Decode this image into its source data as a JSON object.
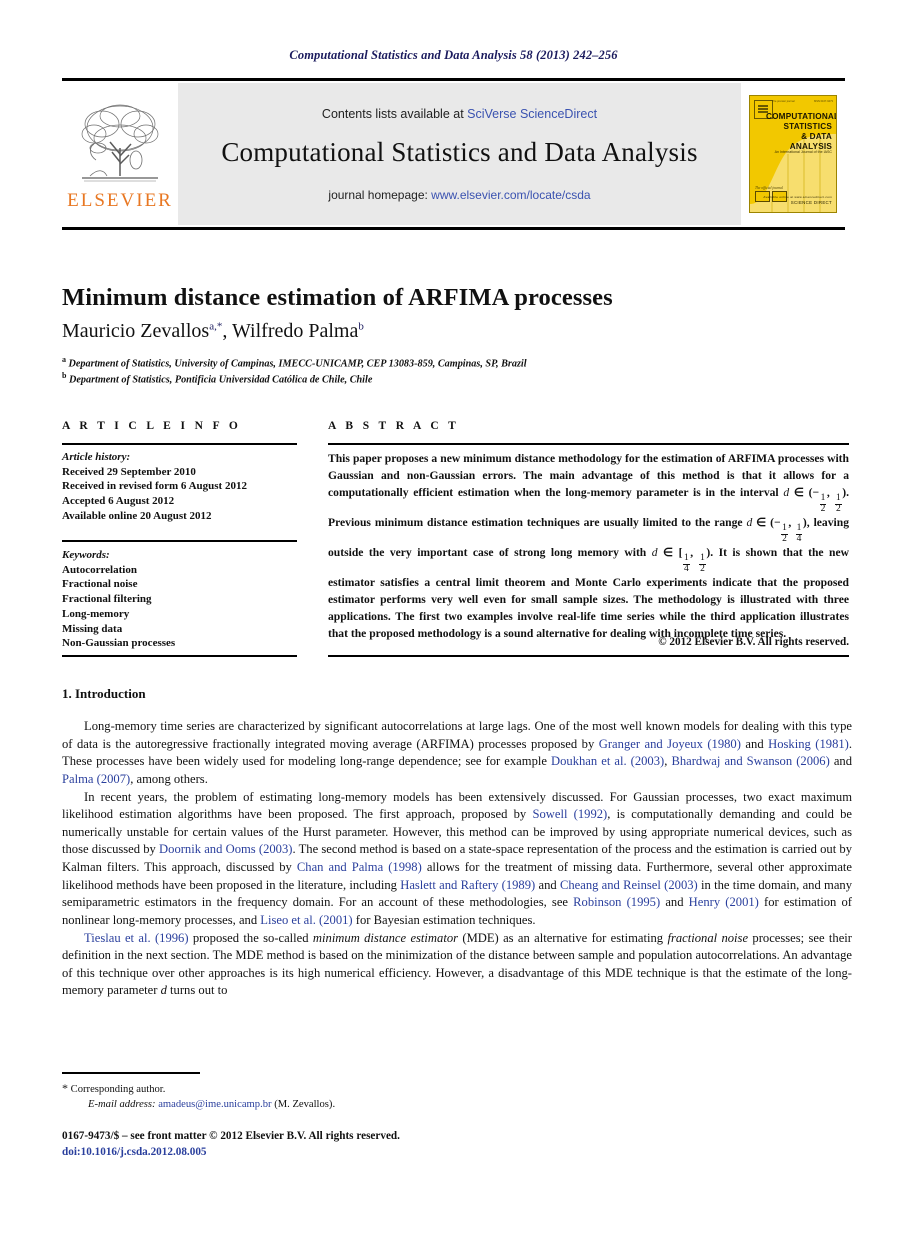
{
  "running_head": "Computational Statistics and Data Analysis 58 (2013) 242–256",
  "masthead": {
    "contents_prefix": "Contents lists available at ",
    "contents_link": "SciVerse ScienceDirect",
    "journal_title": "Computational Statistics and Data Analysis",
    "homepage_prefix": "journal homepage: ",
    "homepage_link": "www.elsevier.com/locate/csda",
    "publisher_wordmark": "ELSEVIER",
    "band_bg": "#e9e9e9",
    "link_color": "#3a52b0",
    "elsevier_orange": "#E87722",
    "cover": {
      "top_left_label": "The premier journal",
      "top_right_label": "ISSN 0167-9473",
      "title_lines": [
        "COMPUTATIONAL",
        "STATISTICS",
        "& DATA ANALYSIS"
      ],
      "subtitle": "An International Journal of the IASC",
      "quote": "The official journal",
      "bottom_small": "Available online at www.sciencedirect.com",
      "bottom_big": "SCIENCE DIRECT",
      "bg": "#F2C800"
    }
  },
  "article": {
    "title": "Minimum distance estimation of ARFIMA processes",
    "authors": [
      {
        "name": "Mauricio Zevallos",
        "marks": "a,*"
      },
      {
        "name": "Wilfredo Palma",
        "marks": "b"
      }
    ],
    "affiliations": [
      {
        "mark": "a",
        "text": "Department of Statistics, University of Campinas, IMECC-UNICAMP, CEP 13083-859, Campinas, SP, Brazil"
      },
      {
        "mark": "b",
        "text": "Department of Statistics, Pontificia Universidad Católica de Chile, Chile"
      }
    ]
  },
  "article_info": {
    "heading": "A R T I C L E   I N F O",
    "history_label": "Article history:",
    "history": [
      "Received 29 September 2010",
      "Received in revised form 6 August 2012",
      "Accepted 6 August 2012",
      "Available online 20 August 2012"
    ],
    "keywords_label": "Keywords:",
    "keywords": [
      "Autocorrelation",
      "Fractional noise",
      "Fractional filtering",
      "Long-memory",
      "Missing data",
      "Non-Gaussian processes"
    ]
  },
  "abstract": {
    "heading": "A B S T R A C T",
    "part1": "This paper proposes a new minimum distance methodology for the estimation of ARFIMA processes with Gaussian and non-Gaussian errors. The main advantage of this method is that it allows for a computationally efficient estimation when the long-memory parameter is in the interval ",
    "interval1_var": "d",
    "interval1_open": " ∈ (−",
    "interval1_f1_num": "1",
    "interval1_f1_den": "2",
    "interval1_mid": ", ",
    "interval1_f2_num": "1",
    "interval1_f2_den": "2",
    "interval1_close": "). ",
    "part2": "Previous minimum distance estimation techniques are usually limited to the range ",
    "interval2_var": "d",
    "interval2_open": " ∈ (−",
    "interval2_f1_num": "1",
    "interval2_f1_den": "2",
    "interval2_mid": ", ",
    "interval2_f2_num": "1",
    "interval2_f2_den": "4",
    "interval2_close": "), ",
    "part3": "leaving outside the very important case of strong long memory with ",
    "interval3_var": "d",
    "interval3_open": " ∈ [",
    "interval3_f1_num": "1",
    "interval3_f1_den": "4",
    "interval3_mid": ", ",
    "interval3_f2_num": "1",
    "interval3_f2_den": "2",
    "interval3_close": "). ",
    "part4": "It is shown that the new estimator satisfies a central limit theorem and Monte Carlo experiments indicate that the proposed estimator performs very well even for small sample sizes. The methodology is illustrated with three applications. The first two examples involve real-life time series while the third application illustrates that the proposed methodology is a sound alternative for dealing with incomplete time series.",
    "copyright": "© 2012 Elsevier B.V. All rights reserved."
  },
  "body": {
    "section_number": "1.",
    "section_title": "Introduction",
    "p1": {
      "t1": "Long-memory time series are characterized by significant autocorrelations at large lags. One of the most well known models for dealing with this type of data is the autoregressive fractionally integrated moving average (ARFIMA) processes proposed by ",
      "c1": "Granger and Joyeux (1980)",
      "t2": " and ",
      "c2": "Hosking (1981)",
      "t3": ". These processes have been widely used for modeling long-range dependence; see for example ",
      "c3": "Doukhan et al. (2003)",
      "t4": ", ",
      "c4": "Bhardwaj and Swanson (2006)",
      "t5": " and ",
      "c5": "Palma (2007)",
      "t6": ", among others."
    },
    "p2": {
      "t1": "In recent years, the problem of estimating long-memory models has been extensively discussed. For Gaussian processes, two exact maximum likelihood estimation algorithms have been proposed. The first approach, proposed by ",
      "c1": "Sowell (1992)",
      "t2": ", is computationally demanding and could be numerically unstable for certain values of the Hurst parameter. However, this method can be improved by using appropriate numerical devices, such as those discussed by ",
      "c2": "Doornik and Ooms (2003)",
      "t3": ". The second method is based on a state-space representation of the process and the estimation is carried out by Kalman filters. This approach, discussed by ",
      "c3": "Chan and Palma (1998)",
      "t4": " allows for the treatment of missing data. Furthermore, several other approximate likelihood methods have been proposed in the literature, including ",
      "c4": "Haslett and Raftery (1989)",
      "t5": " and ",
      "c5": "Cheang and Reinsel (2003)",
      "t6": " in the time domain, and many semiparametric estimators in the frequency domain. For an account of these methodologies, see ",
      "c6": "Robinson (1995)",
      "t7": " and ",
      "c7": "Henry (2001)",
      "t8": " for estimation of nonlinear long-memory processes, and ",
      "c8": "Liseo et al. (2001)",
      "t9": " for Bayesian estimation techniques."
    },
    "p3": {
      "c1": "Tieslau et al. (1996)",
      "t1": " proposed the so-called ",
      "i1": "minimum distance estimator",
      "t2": " (MDE) as an alternative for estimating ",
      "i2": "fractional noise",
      "t3": " processes; see their definition in the next section. The MDE method is based on the minimization of the distance between sample and population autocorrelations. An advantage of this technique over other approaches is its high numerical efficiency. However, a disadvantage of this MDE technique is that the estimate of the long-memory parameter ",
      "i3": "d",
      "t4": " turns out to"
    }
  },
  "footnotes": {
    "corresponding_star": "*",
    "corresponding_text": "Corresponding author.",
    "email_label": "E-mail address:",
    "email": "amadeus@ime.unicamp.br",
    "email_suffix": " (M. Zevallos).",
    "issn_line": "0167-9473/$ – see front matter © 2012 Elsevier B.V. All rights reserved.",
    "doi_line": "doi:10.1016/j.csda.2012.08.005"
  }
}
